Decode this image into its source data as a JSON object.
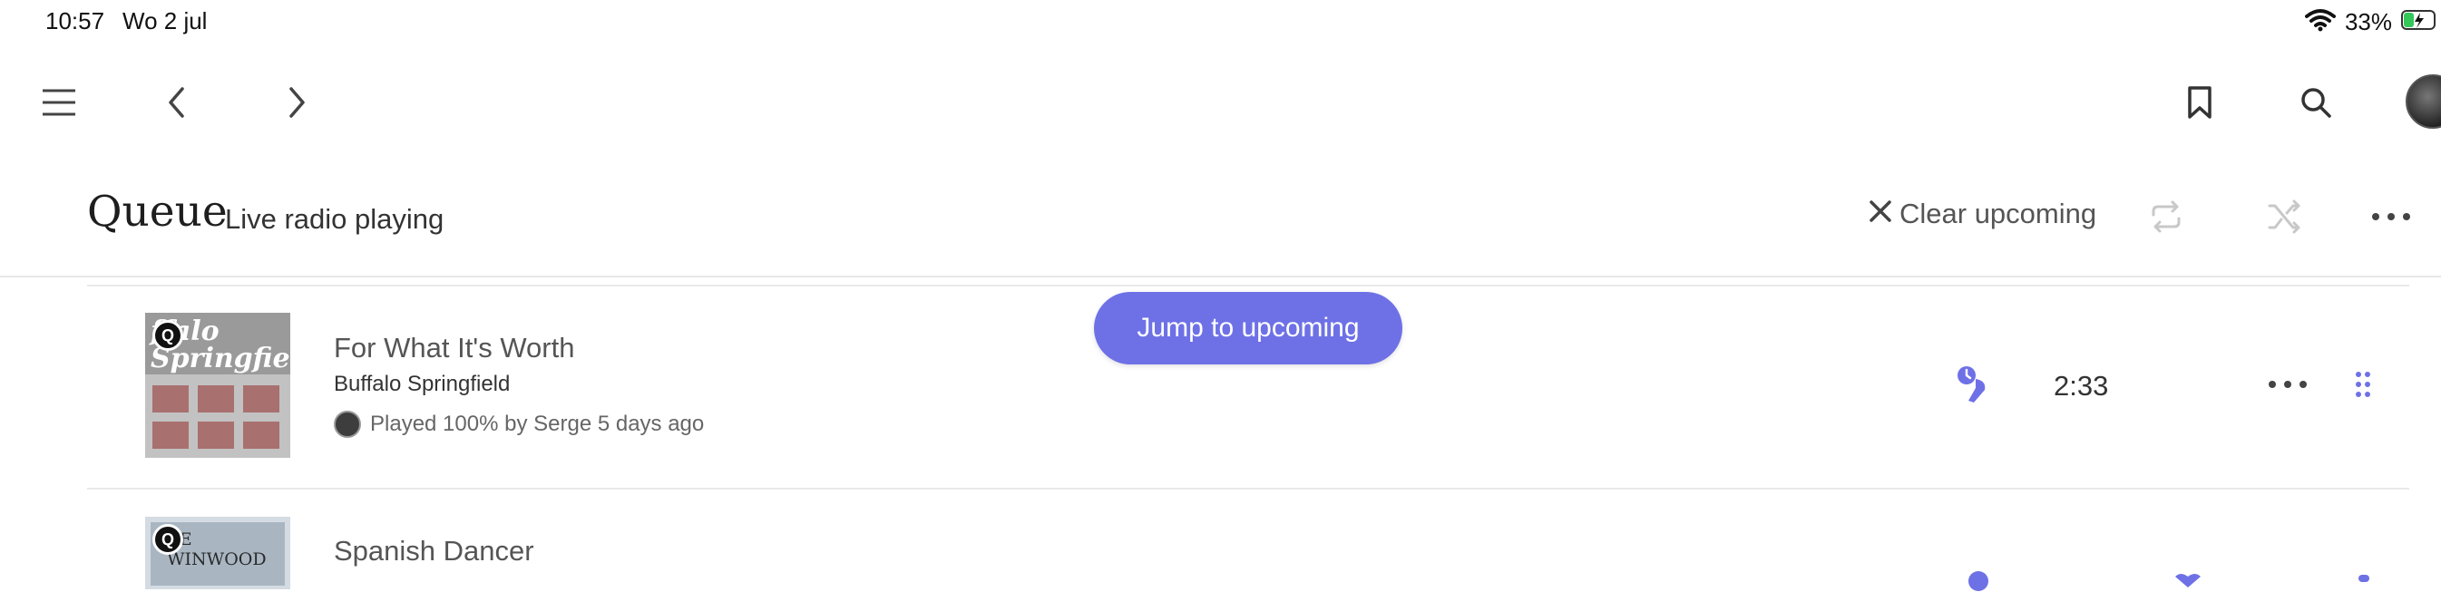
{
  "status": {
    "time": "10:57",
    "date": "Wo 2 jul",
    "battery_pct": "33%",
    "battery_level": 0.33
  },
  "nav": {
    "menu_icon": "hamburger-icon",
    "back_icon": "chevron-left-icon",
    "forward_icon": "chevron-right-icon",
    "bookmark_icon": "bookmark-icon",
    "search_icon": "search-icon"
  },
  "header": {
    "title": "Queue",
    "subtitle": "Live radio playing",
    "clear_label": "Clear upcoming",
    "repeat_icon": "repeat-icon",
    "shuffle_icon": "shuffle-icon",
    "more_icon": "more-horizontal-icon"
  },
  "jump_button": "Jump to upcoming",
  "tracks": [
    {
      "title": "For What It's Worth",
      "artist": "Buffalo Springfield",
      "meta": "Played 100% by Serge 5 days ago",
      "duration": "2:33",
      "art_text": "ffalo Springfield"
    },
    {
      "title": "Spanish Dancer",
      "art_text": "VE WINWOOD"
    }
  ],
  "colors": {
    "accent": "#6e71e6",
    "text": "#222222",
    "divider": "#e6e6e6"
  }
}
